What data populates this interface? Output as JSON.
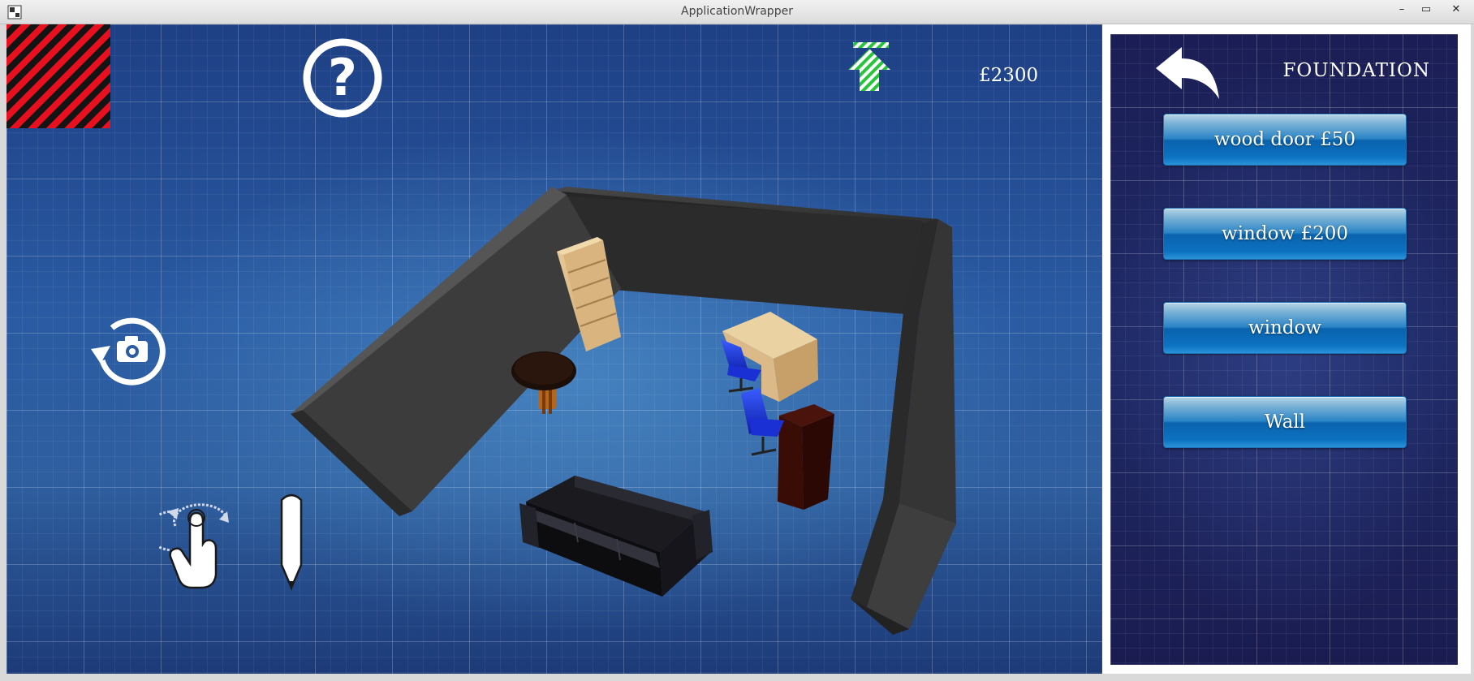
{
  "window": {
    "title": "ApplicationWrapper",
    "buttons": {
      "minimize": "–",
      "maximize": "▭",
      "close": "✕"
    }
  },
  "hud": {
    "money": "£2300",
    "icons": {
      "hatch": "red-black-hatch-icon",
      "help": "question-mark-icon",
      "level_up": "striped-up-arrow-icon",
      "camera": "rotate-camera-icon",
      "rotate": "hand-rotate-icon",
      "draw": "pencil-icon"
    }
  },
  "panel": {
    "title": "FOUNDATION",
    "back_icon": "back-arrow-icon",
    "items": [
      {
        "label": "wood door £50"
      },
      {
        "label": "window £200"
      },
      {
        "label": "window"
      },
      {
        "label": "Wall"
      }
    ]
  },
  "colors": {
    "accent_red": "#e8101e",
    "arrow_green": "#27c53a",
    "button_blue": "#0a62ad",
    "wall_gray": "#3a3a3a"
  }
}
